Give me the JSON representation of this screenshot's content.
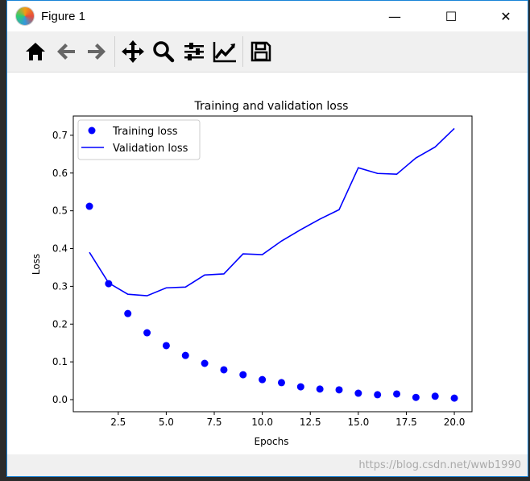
{
  "window": {
    "title": "Figure 1",
    "minimize": "—",
    "maximize": "☐",
    "close": "✕"
  },
  "toolbar": {
    "icons": [
      "home-icon",
      "back-icon",
      "forward-icon",
      "pan-icon",
      "zoom-icon",
      "configure-subplots-icon",
      "edit-axis-icon",
      "save-icon"
    ]
  },
  "watermark": "https://blog.csdn.net/wwb1990",
  "chart_data": {
    "type": "scatter+line",
    "title": "Training and validation loss",
    "xlabel": "Epochs",
    "ylabel": "Loss",
    "xlim": [
      0.16,
      20.92
    ],
    "ylim": [
      -0.032,
      0.751
    ],
    "xticks": [
      2.5,
      5.0,
      7.5,
      10.0,
      12.5,
      15.0,
      17.5,
      20.0
    ],
    "xtick_labels": [
      "2.5",
      "5.0",
      "7.5",
      "10.0",
      "12.5",
      "15.0",
      "17.5",
      "20.0"
    ],
    "yticks": [
      0,
      0.1,
      0.2,
      0.3,
      0.4,
      0.5,
      0.6,
      0.7
    ],
    "ytick_labels": [
      "0.0",
      "0.1",
      "0.2",
      "0.3",
      "0.4",
      "0.5",
      "0.6",
      "0.7"
    ],
    "grid": false,
    "legend_position": "top-left",
    "x": [
      1,
      2,
      3,
      4,
      5,
      6,
      7,
      8,
      9,
      10,
      11,
      12,
      13,
      14,
      15,
      16,
      17,
      18,
      19,
      20
    ],
    "series": [
      {
        "name": "Training loss",
        "style": "dots",
        "color": "#0000ff",
        "values": [
          0.512,
          0.307,
          0.228,
          0.177,
          0.143,
          0.117,
          0.096,
          0.079,
          0.066,
          0.053,
          0.045,
          0.034,
          0.028,
          0.026,
          0.017,
          0.013,
          0.015,
          0.006,
          0.009,
          0.004
        ]
      },
      {
        "name": "Validation loss",
        "style": "line",
        "color": "#0000ff",
        "values": [
          0.39,
          0.309,
          0.279,
          0.275,
          0.296,
          0.298,
          0.33,
          0.333,
          0.386,
          0.384,
          0.42,
          0.45,
          0.478,
          0.503,
          0.614,
          0.599,
          0.597,
          0.64,
          0.669,
          0.718
        ]
      }
    ]
  }
}
